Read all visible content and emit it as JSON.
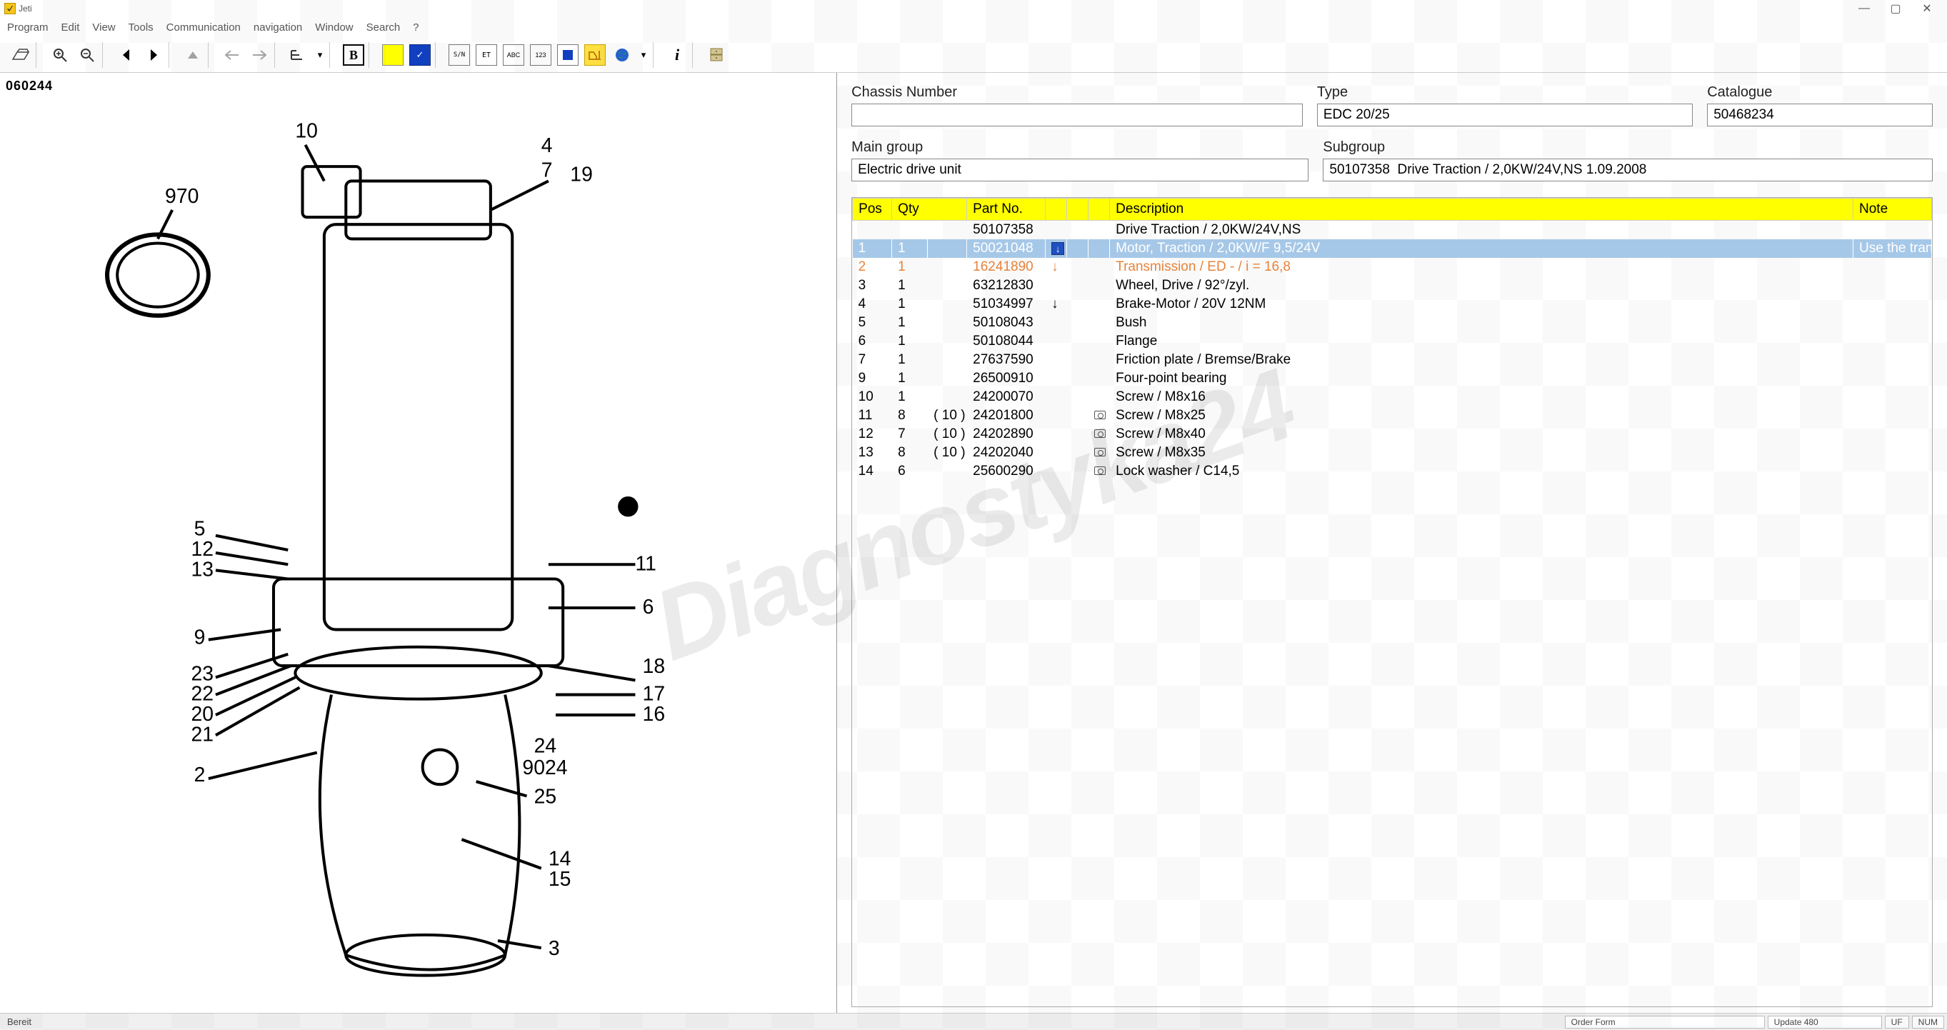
{
  "window_title": "Jeti",
  "menu": [
    "Program",
    "Edit",
    "View",
    "Tools",
    "Communication",
    "navigation",
    "Window",
    "Search",
    "?"
  ],
  "page_code": "060244",
  "form": {
    "chassis_label": "Chassis Number",
    "chassis_value": "",
    "type_label": "Type",
    "type_value": "EDC 20/25",
    "catalogue_label": "Catalogue",
    "catalogue_value": "50468234",
    "maingroup_label": "Main group",
    "maingroup_value": "Electric drive unit",
    "subgroup_label": "Subgroup",
    "subgroup_value": "50107358  Drive Traction / 2,0KW/24V,NS 1.09.2008"
  },
  "table": {
    "headers": {
      "pos": "Pos",
      "qty": "Qty",
      "part": "Part No.",
      "desc": "Description",
      "note": "Note"
    },
    "rows": [
      {
        "pos": "",
        "qty": "",
        "qty2": "",
        "part": "50107358",
        "arrow": "",
        "cam": "",
        "desc": "Drive Traction / 2,0KW/24V,NS",
        "note": "",
        "cls": ""
      },
      {
        "pos": "1",
        "qty": "1",
        "qty2": "",
        "part": "50021048",
        "arrow": "badge",
        "cam": "",
        "desc": "Motor, Traction / 2,0KW/F 9,5/24V",
        "note": "Use the tran",
        "cls": "selected"
      },
      {
        "pos": "2",
        "qty": "1",
        "qty2": "",
        "part": "16241890",
        "arrow": "↓",
        "cam": "",
        "desc": "Transmission / ED - / i = 16,8",
        "note": "",
        "cls": "orange"
      },
      {
        "pos": "3",
        "qty": "1",
        "qty2": "",
        "part": "63212830",
        "arrow": "",
        "cam": "",
        "desc": "Wheel, Drive / 92°/zyl.",
        "note": "",
        "cls": ""
      },
      {
        "pos": "4",
        "qty": "1",
        "qty2": "",
        "part": "51034997",
        "arrow": "↓",
        "cam": "",
        "desc": "Brake-Motor / 20V 12NM",
        "note": "",
        "cls": ""
      },
      {
        "pos": "5",
        "qty": "1",
        "qty2": "",
        "part": "50108043",
        "arrow": "",
        "cam": "",
        "desc": "Bush",
        "note": "",
        "cls": ""
      },
      {
        "pos": "6",
        "qty": "1",
        "qty2": "",
        "part": "50108044",
        "arrow": "",
        "cam": "",
        "desc": "Flange",
        "note": "",
        "cls": ""
      },
      {
        "pos": "7",
        "qty": "1",
        "qty2": "",
        "part": "27637590",
        "arrow": "",
        "cam": "",
        "desc": "Friction plate / Bremse/Brake",
        "note": "",
        "cls": ""
      },
      {
        "pos": "9",
        "qty": "1",
        "qty2": "",
        "part": "26500910",
        "arrow": "",
        "cam": "",
        "desc": "Four-point bearing",
        "note": "",
        "cls": ""
      },
      {
        "pos": "10",
        "qty": "1",
        "qty2": "",
        "part": "24200070",
        "arrow": "",
        "cam": "",
        "desc": "Screw / M8x16",
        "note": "",
        "cls": ""
      },
      {
        "pos": "11",
        "qty": "8",
        "qty2": "( 10 )",
        "part": "24201800",
        "arrow": "",
        "cam": "y",
        "desc": "Screw / M8x25",
        "note": "",
        "cls": ""
      },
      {
        "pos": "12",
        "qty": "7",
        "qty2": "( 10 )",
        "part": "24202890",
        "arrow": "",
        "cam": "y",
        "desc": "Screw / M8x40",
        "note": "",
        "cls": ""
      },
      {
        "pos": "13",
        "qty": "8",
        "qty2": "( 10 )",
        "part": "24202040",
        "arrow": "",
        "cam": "y",
        "desc": "Screw / M8x35",
        "note": "",
        "cls": ""
      },
      {
        "pos": "14",
        "qty": "6",
        "qty2": "",
        "part": "25600290",
        "arrow": "",
        "cam": "y",
        "desc": "Lock washer / C14,5",
        "note": "",
        "cls": ""
      }
    ]
  },
  "status": {
    "ready": "Bereit",
    "order": "Order Form",
    "update": "Update 480",
    "uf": "UF",
    "num": "NUM"
  },
  "callouts": [
    "970",
    "10",
    "4",
    "7",
    "19",
    "5",
    "12",
    "13",
    "11",
    "6",
    "9",
    "18",
    "23",
    "22",
    "20",
    "21",
    "17",
    "16",
    "2",
    "24",
    "9024",
    "25",
    "14",
    "15",
    "3"
  ]
}
